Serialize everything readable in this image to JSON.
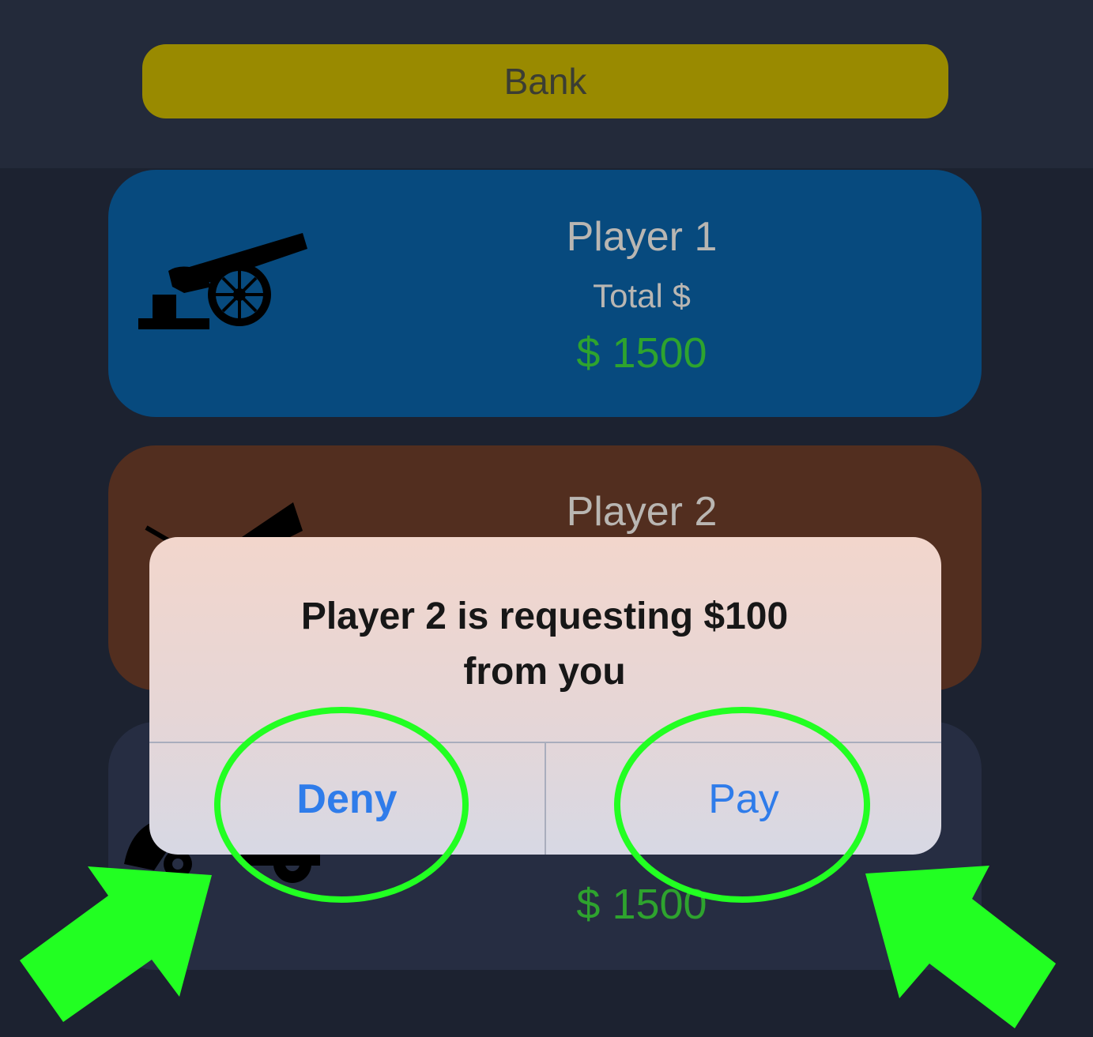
{
  "bank": {
    "label": "Bank"
  },
  "players": [
    {
      "name": "Player 1",
      "total_label": "Total $",
      "amount": "$ 1500"
    },
    {
      "name": "Player 2"
    },
    {
      "amount": "$ 1500"
    }
  ],
  "dialog": {
    "message_line1": "Player 2 is requesting $100",
    "message_line2": "from you",
    "deny_label": "Deny",
    "pay_label": "Pay"
  },
  "colors": {
    "background": "#1c2230",
    "bank": "#998a00",
    "player1_card": "#074a7e",
    "player2_card": "#522e1f",
    "player3_card": "#262d42",
    "amount_green": "#2ea32e",
    "dialog_button_blue": "#2f7cea",
    "highlight_green": "#22ff22"
  },
  "icons": [
    "cannon-icon",
    "arrow-icon"
  ]
}
